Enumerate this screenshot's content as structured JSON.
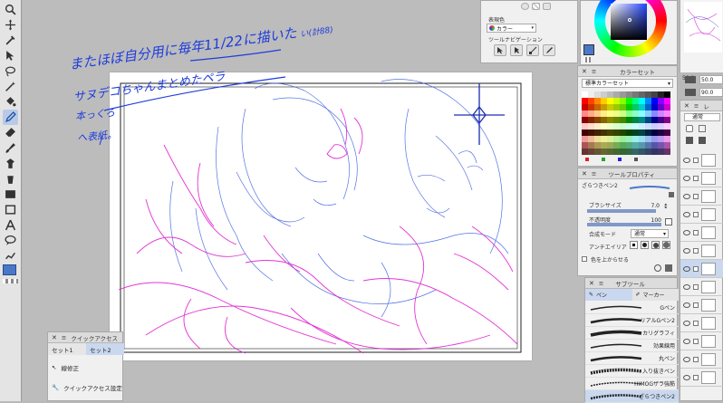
{
  "colors": {
    "accent": "#3b6fd4",
    "magenta_line": "#e020d0",
    "blue_line": "#2a4fd0",
    "annotation": "#1e3cdc",
    "current_color": "#4a78c9"
  },
  "toolbar": {
    "tools": [
      "zoom-icon",
      "move-icon",
      "eyedropper-icon",
      "pen-icon",
      "select-icon",
      "lasso-icon",
      "wand-icon",
      "brush-icon",
      "paint-icon",
      "eraser-icon",
      "blend-icon",
      "fill-icon",
      "gradient-icon",
      "figure-icon",
      "frame-icon",
      "text-icon",
      "balloon-icon",
      "line-icon",
      "sub-icon"
    ]
  },
  "annotation": {
    "line1": "またほぼ自分用に毎年11/22に描いた",
    "line1_tail": "い(計88)",
    "line2": "サヌデコちゃんまとめたペラ",
    "line3": "本っくろ",
    "line4": "へ表紙。"
  },
  "display_panel": {
    "label": "表現色",
    "mode": "カラー",
    "nav_label": "ツールナビゲーション"
  },
  "color_set": {
    "title": "カラーセット",
    "set_name": "標準カラーセット"
  },
  "nav_values": {
    "zoom": "50.0",
    "rotate": "90.0"
  },
  "tool_property": {
    "title": "ツールプロパティ",
    "tool_name": "ざらつきペン2",
    "brush_size_label": "ブラシサイズ",
    "brush_size": "7.0",
    "opacity_label": "不透明度",
    "opacity": "100",
    "blend_label": "合成モード",
    "blend_value": "通常",
    "antialias_label": "アンチエイリア",
    "bottom_label": "色を上からせる"
  },
  "subtool": {
    "title": "サブツール",
    "tab_pen": "ペン",
    "tab_marker": "マーカー",
    "brushes": [
      "Gペン",
      "リアルGペン2",
      "カリグラフィ",
      "効果線用",
      "丸ペン",
      "入り抜きペン",
      "HIMOGザラ強筋",
      "ざらつきペン2"
    ]
  },
  "layer_panel": {
    "title": "レ",
    "blend": "通常"
  },
  "quick_access": {
    "title": "クイックアクセス",
    "tab1": "セット1",
    "tab2": "セット2",
    "item1": "線修正",
    "item2": "クイックアクセス設定"
  }
}
